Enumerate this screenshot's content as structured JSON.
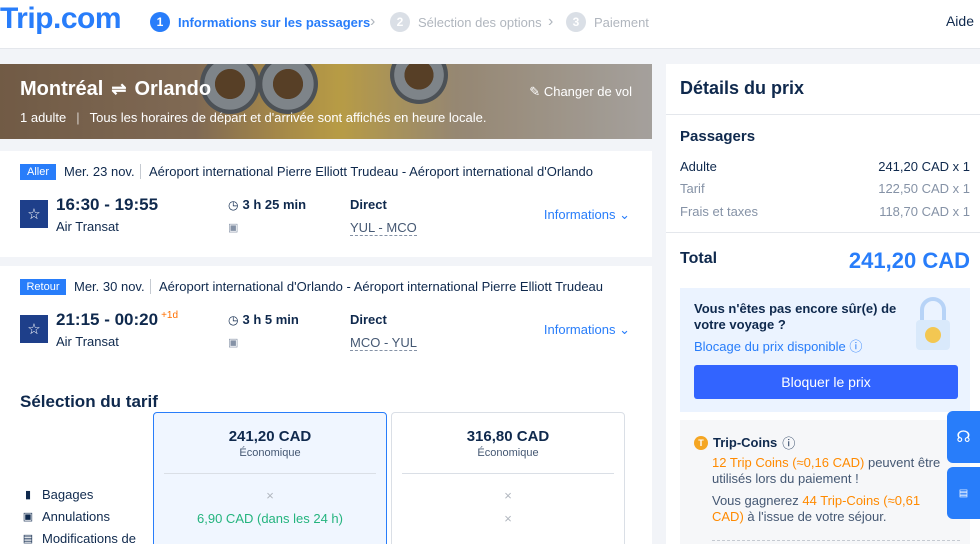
{
  "header": {
    "logo": "Trip.com",
    "steps": [
      {
        "num": "1",
        "label": "Informations sur les passagers"
      },
      {
        "num": "2",
        "label": "Sélection des options"
      },
      {
        "num": "3",
        "label": "Paiement"
      }
    ],
    "help": "Aide"
  },
  "banner": {
    "from": "Montréal",
    "to": "Orlando",
    "passengers": "1 adulte",
    "note": "Tous les horaires de départ et d'arrivée sont affichés en heure locale.",
    "change": "Changer de vol"
  },
  "segments": [
    {
      "tag": "Aller",
      "date": "Mer. 23 nov.",
      "airports": "Aéroport international Pierre Elliott Trudeau - Aéroport international d'Orlando",
      "times": "16:30 - 19:55",
      "day_offset": "",
      "airline": "Air Transat",
      "duration": "3 h 25 min",
      "stops": "Direct",
      "codes": "YUL - MCO",
      "info": "Informations"
    },
    {
      "tag": "Retour",
      "date": "Mer. 30 nov.",
      "airports": "Aéroport international d'Orlando - Aéroport international Pierre Elliott Trudeau",
      "times": "21:15 - 00:20",
      "day_offset": "+1d",
      "airline": "Air Transat",
      "duration": "3 h 5 min",
      "stops": "Direct",
      "codes": "MCO - YUL",
      "info": "Informations"
    }
  ],
  "tarif": {
    "title": "Sélection du tarif",
    "features": [
      "Bagages",
      "Annulations",
      "Modifications de"
    ],
    "fares": [
      {
        "price": "241,20 CAD",
        "class": "Économique",
        "bagages": "×",
        "annulations": "6,90 CAD (dans les 24 h)"
      },
      {
        "price": "316,80 CAD",
        "class": "Économique",
        "bagages": "×",
        "annulations": "×"
      }
    ]
  },
  "price": {
    "title": "Détails du prix",
    "passengers_title": "Passagers",
    "rows": [
      {
        "label": "Adulte",
        "value": "241,20 CAD x 1"
      },
      {
        "label": "Tarif",
        "value": "122,50 CAD x 1"
      },
      {
        "label": "Frais et taxes",
        "value": "118,70 CAD x 1"
      }
    ],
    "total_label": "Total",
    "total_value": "241,20 CAD",
    "lock_question": "Vous n'êtes pas encore sûr(e) de votre voyage ?",
    "lock_link": "Blocage du prix disponible",
    "lock_button": "Bloquer le prix"
  },
  "coins": {
    "title": "Trip-Coins",
    "line1_highlight": "12 Trip Coins (≈0,16 CAD)",
    "line1_rest": " peuvent être utilisés lors du paiement !",
    "line2_pre": "Vous gagnerez ",
    "line2_highlight": "44 Trip-Coins (≈0,61 CAD)",
    "line2_rest": " à l'issue de votre séjour."
  },
  "colors": {
    "brand": "#287dfa",
    "accent_orange": "#ff8a00",
    "teal": "#24b47e"
  }
}
